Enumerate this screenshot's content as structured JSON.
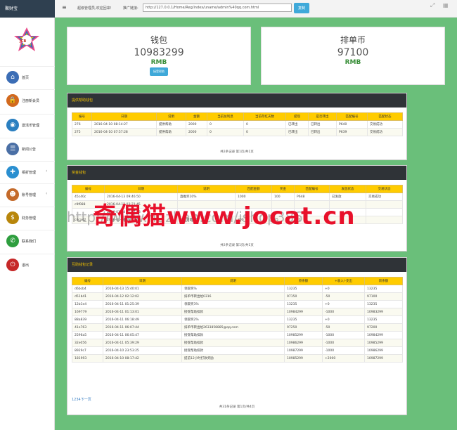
{
  "header": {
    "brand": "聚财宝",
    "menu_icon": "≡",
    "welcome": "超级管理员,欢迎回来!",
    "promo_label": "推广链接:",
    "promo_url": "http://127.0.0.1/Home/Reg/index/uname/admin%40qq.com.html",
    "copy_label": "复制"
  },
  "sidebar": {
    "logo_text": "JCB",
    "items": [
      {
        "label": "首页",
        "icon": "home-icon",
        "color": "#3b6db5"
      },
      {
        "label": "注册新会员",
        "icon": "lock-icon",
        "color": "#d2691e"
      },
      {
        "label": "激活币管理",
        "icon": "globe-icon",
        "color": "#2a7fc0"
      },
      {
        "label": "新闻公告",
        "icon": "news-icon",
        "color": "#4a6fa5"
      },
      {
        "label": "相折管理",
        "icon": "puzzle-icon",
        "color": "#2a8fd0"
      },
      {
        "label": "账号管理",
        "icon": "users-icon",
        "color": "#c46a2a"
      },
      {
        "label": "财务管理",
        "icon": "dollar-icon",
        "color": "#b8860b"
      },
      {
        "label": "联系我们",
        "icon": "contact-icon",
        "color": "#2e9e3e"
      },
      {
        "label": "退出",
        "icon": "power-icon",
        "color": "#c62828"
      }
    ]
  },
  "wallet": {
    "title": "钱包",
    "value": "10983299",
    "unit": "RMB",
    "button": "接受帮助"
  },
  "queue": {
    "title": "排单币",
    "value": "97100",
    "unit": "RMB"
  },
  "help_panel": {
    "title": "提供帮助钱包",
    "headers": [
      "编号",
      "日期",
      "说明",
      "金额",
      "当前总利息",
      "当前存红天数",
      "提现",
      "是否转出",
      "匹配编号",
      "匹配状态"
    ],
    "rows": [
      [
        "276",
        "2016-04-10 08:14:27",
        "提供帮助",
        "2000",
        "0",
        "0",
        "已转出",
        "已转出",
        "P640",
        "交易成功"
      ],
      [
        "275",
        "2016-04-10 07:57:28",
        "提供帮助",
        "2000",
        "0",
        "0",
        "已转出",
        "已转出",
        "P639",
        "交易成功"
      ]
    ],
    "pager": "共2条记录 第1页/共1页"
  },
  "bonus_panel": {
    "title": "奖金钱包",
    "headers": [
      "编号",
      "日期",
      "说明",
      "匹配金额",
      "奖金",
      "匹配编号",
      "发放状态",
      "交易状态"
    ],
    "rows": [
      [
        "45c40c",
        "2016-04-13 09:46:50",
        "直推奖10%",
        "1000",
        "100",
        "P648",
        "已发放",
        "交易成功"
      ],
      [
        "c9f088",
        "2016-04-12 03:21:45",
        "",
        "",
        "",
        "",
        "",
        ""
      ],
      [
        "",
        "2016-01-24 11:47:58",
        "",
        "",
        "",
        "",
        "",
        ""
      ],
      [
        "c4ca42",
        "2016-01-24 11:47:58",
        "经理奖第1代",
        "300",
        "15",
        "P1",
        "",
        ""
      ]
    ],
    "pager": "共2条记录 第1页/共1页"
  },
  "record_panel": {
    "title": "互助钱包记录",
    "headers": [
      "编号",
      "日期",
      "说明",
      "原余额",
      "+收入/-支出",
      "新余额"
    ],
    "rows": [
      [
        "d6bcb4",
        "2016-04-13 15:40:01",
        "领取奖%",
        "13235",
        "+0",
        "13235"
      ],
      [
        "d51b41",
        "2016-04-12 02:12:02",
        "排单币转出给0316",
        "97150",
        "-50",
        "97100"
      ],
      [
        "12b1e4",
        "2016-04-11 01:25:39",
        "领取奖3%",
        "13235",
        "+0",
        "13235"
      ],
      [
        "169779",
        "2016-04-11 01:13:01",
        "接受帮助扣款",
        "10984299",
        "-1000",
        "10983299"
      ],
      [
        "88a839",
        "2016-04-11 06:18:49",
        "领取奖2%",
        "13235",
        "+0",
        "13235"
      ],
      [
        "41e763",
        "2016-04-11 06:07:44",
        "排单币转出给2633858885@qq.com",
        "97250",
        "-50",
        "97200"
      ],
      [
        "2596a5",
        "2016-04-11 06:05:47",
        "接受帮助扣款",
        "10985299",
        "-1000",
        "10984299"
      ],
      [
        "32e056",
        "2016-04-11 05:39:29",
        "接受帮助扣款",
        "10986299",
        "-1000",
        "10985299"
      ],
      [
        "8929c7",
        "2016-04-10 23:53:25",
        "接受帮助扣款",
        "10987299",
        "-1000",
        "10986299"
      ],
      [
        "181993",
        "2016-04-10 08:17:42",
        "提前12小时打款奖励",
        "10985299",
        "+2000",
        "10987299"
      ]
    ],
    "pager_links": "1234下一页",
    "pager": "共31条记录 第1页/共4页"
  },
  "watermark": {
    "text": "奇偶猫www.jocat.cn",
    "shadow": "http://www.huzhan.com/ishop386"
  }
}
